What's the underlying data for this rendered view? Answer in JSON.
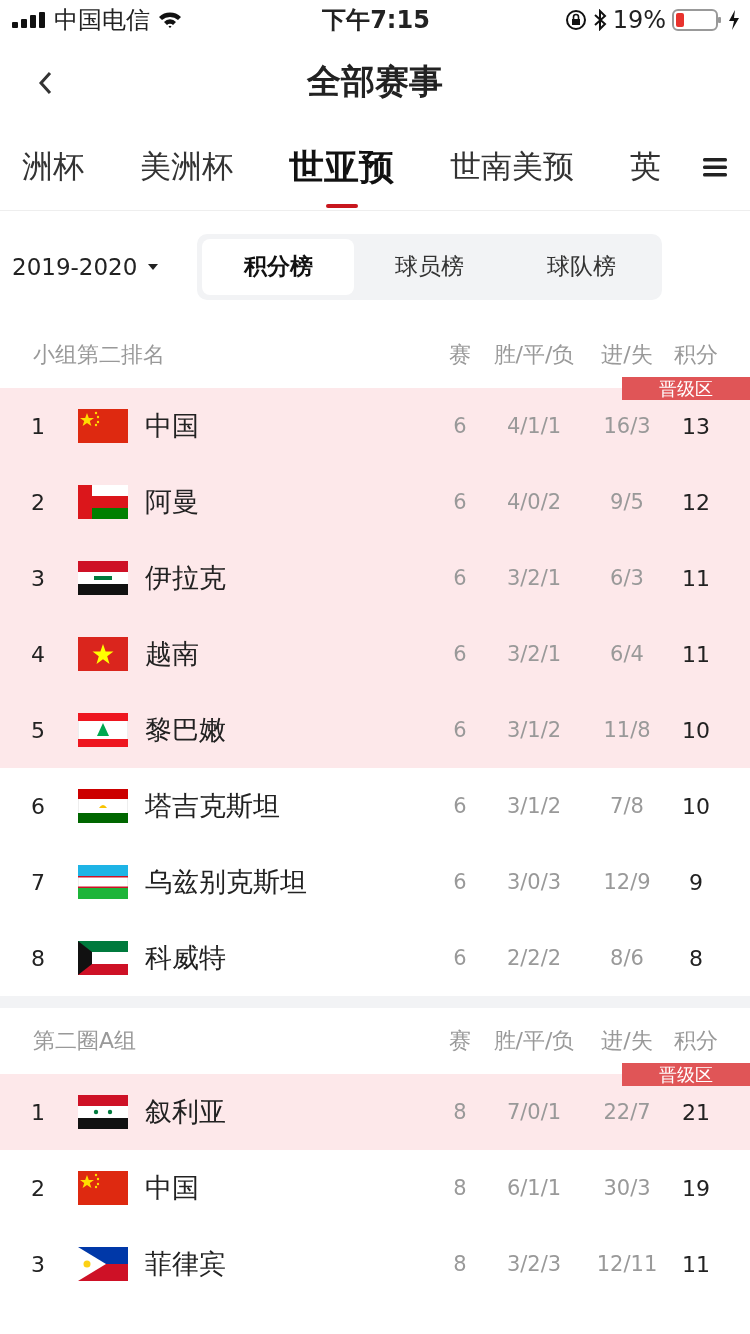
{
  "status_bar": {
    "carrier": "中国电信",
    "time": "下午7:15",
    "battery": "19%"
  },
  "nav": {
    "title": "全部赛事"
  },
  "tabs": [
    {
      "label": "洲杯",
      "selected": false
    },
    {
      "label": "美洲杯",
      "selected": false
    },
    {
      "label": "世亚预",
      "selected": true
    },
    {
      "label": "世南美预",
      "selected": false
    },
    {
      "label": "英",
      "selected": false
    }
  ],
  "season": "2019-2020",
  "segments": [
    {
      "label": "积分榜",
      "selected": true
    },
    {
      "label": "球员榜",
      "selected": false
    },
    {
      "label": "球队榜",
      "selected": false
    }
  ],
  "groups": [
    {
      "title": "小组第二排名",
      "columns": [
        "赛",
        "胜/平/负",
        "进/失",
        "积分"
      ],
      "badge": "晋级区",
      "rows": [
        {
          "rank": "1",
          "kind": "cn",
          "team": "中国",
          "played": "6",
          "wdl": "4/1/1",
          "goals": "16/3",
          "points": "13",
          "promoted": true
        },
        {
          "rank": "2",
          "kind": "om",
          "team": "阿曼",
          "played": "6",
          "wdl": "4/0/2",
          "goals": "9/5",
          "points": "12",
          "promoted": true
        },
        {
          "rank": "3",
          "kind": "iq",
          "team": "伊拉克",
          "played": "6",
          "wdl": "3/2/1",
          "goals": "6/3",
          "points": "11",
          "promoted": true
        },
        {
          "rank": "4",
          "kind": "vn",
          "team": "越南",
          "played": "6",
          "wdl": "3/2/1",
          "goals": "6/4",
          "points": "11",
          "promoted": true
        },
        {
          "rank": "5",
          "kind": "lb",
          "team": "黎巴嫩",
          "played": "6",
          "wdl": "3/1/2",
          "goals": "11/8",
          "points": "10",
          "promoted": true
        },
        {
          "rank": "6",
          "kind": "tj",
          "team": "塔吉克斯坦",
          "played": "6",
          "wdl": "3/1/2",
          "goals": "7/8",
          "points": "10",
          "promoted": false
        },
        {
          "rank": "7",
          "kind": "uz",
          "team": "乌兹别克斯坦",
          "played": "6",
          "wdl": "3/0/3",
          "goals": "12/9",
          "points": "9",
          "promoted": false
        },
        {
          "rank": "8",
          "kind": "kw",
          "team": "科威特",
          "played": "6",
          "wdl": "2/2/2",
          "goals": "8/6",
          "points": "8",
          "promoted": false
        }
      ]
    },
    {
      "title": "第二圈A组",
      "columns": [
        "赛",
        "胜/平/负",
        "进/失",
        "积分"
      ],
      "badge": "晋级区",
      "rows": [
        {
          "rank": "1",
          "kind": "sy",
          "team": "叙利亚",
          "played": "8",
          "wdl": "7/0/1",
          "goals": "22/7",
          "points": "21",
          "promoted": true
        },
        {
          "rank": "2",
          "kind": "cn",
          "team": "中国",
          "played": "8",
          "wdl": "6/1/1",
          "goals": "30/3",
          "points": "19",
          "promoted": false
        },
        {
          "rank": "3",
          "kind": "ph",
          "team": "菲律宾",
          "played": "8",
          "wdl": "3/2/3",
          "goals": "12/11",
          "points": "11",
          "promoted": false
        }
      ]
    }
  ]
}
